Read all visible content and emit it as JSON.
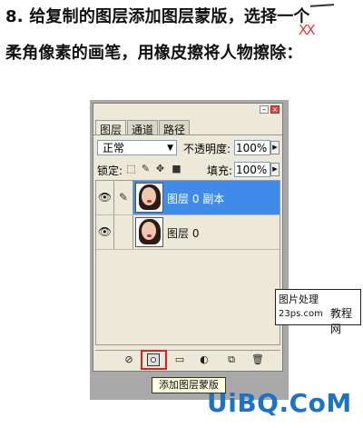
{
  "instructions": {
    "line1": "8. 给复制的图层添加图层蒙版，选择一个",
    "line2": "柔角像素的画笔，用橡皮擦将人物擦除：",
    "mark_xx": "XX"
  },
  "palette": {
    "tabs": [
      "图层",
      "通道",
      "路径"
    ],
    "blend_mode": "正常",
    "opacity_label": "不透明度:",
    "opacity_value": "100%",
    "lock_label": "锁定:",
    "fill_label": "填充:",
    "fill_value": "100%",
    "layers": [
      {
        "name": "图层 0 副本",
        "selected": true
      },
      {
        "name": "图层 0",
        "selected": false
      }
    ],
    "tooltip": "添加图层蒙版"
  },
  "watermark": {
    "line1": "图片处理",
    "line2": "23ps.com",
    "line3": "教程网"
  },
  "logo": "UiBQ.CoM",
  "colors": {
    "selection": "#3e8bea",
    "highlight": "#e02020",
    "logo": "#1a73c7"
  }
}
